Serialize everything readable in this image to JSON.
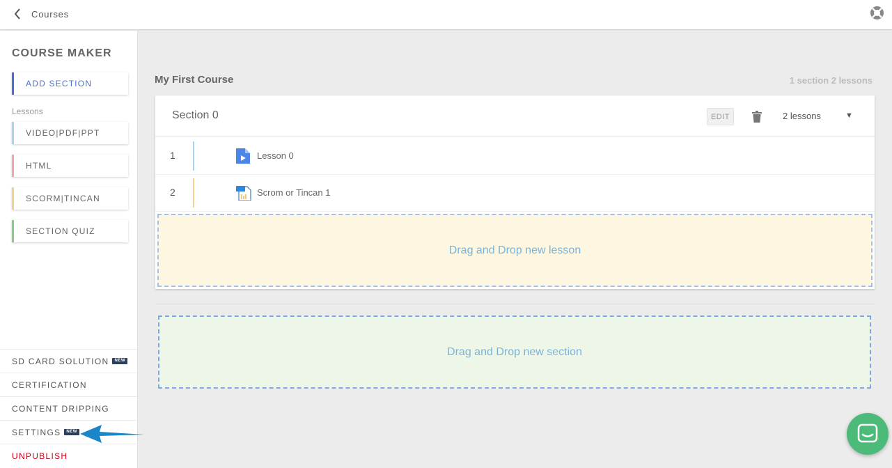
{
  "topbar": {
    "back_label": "Courses"
  },
  "sidebar": {
    "title": "COURSE MAKER",
    "add_section": "ADD SECTION",
    "lessons_label": "Lessons",
    "lesson_types": {
      "video": "VIDEO|PDF|PPT",
      "html": "HTML",
      "scorm": "SCORM|TINCAN",
      "quiz": "SECTION QUIZ"
    },
    "menu": {
      "sd_card": "SD CARD SOLUTION",
      "certification": "CERTIFICATION",
      "content_dripping": "CONTENT DRIPPING",
      "settings": "SETTINGS",
      "unpublish": "UNPUBLISH",
      "new_badge": "NEW"
    }
  },
  "course": {
    "title": "My First Course",
    "summary": "1 section 2 lessons",
    "section": {
      "name": "Section 0",
      "edit_label": "EDIT",
      "lesson_count": "2 lessons",
      "lessons": [
        {
          "number": "1",
          "title": "Lesson 0",
          "icon": "video-file-icon",
          "bar_color": "#a8d2f0"
        },
        {
          "number": "2",
          "title": "Scrom or Tincan 1",
          "icon": "zip-file-icon",
          "bar_color": "#f5cf8e"
        }
      ]
    },
    "drop_lesson": "Drag and Drop new lesson",
    "drop_section": "Drag and Drop new section"
  },
  "colors": {
    "accent_blue": "#4a6fd1",
    "unpublish_red": "#d0021b",
    "chat_green": "#4cbb79",
    "drop_text": "#7ab4d8"
  }
}
